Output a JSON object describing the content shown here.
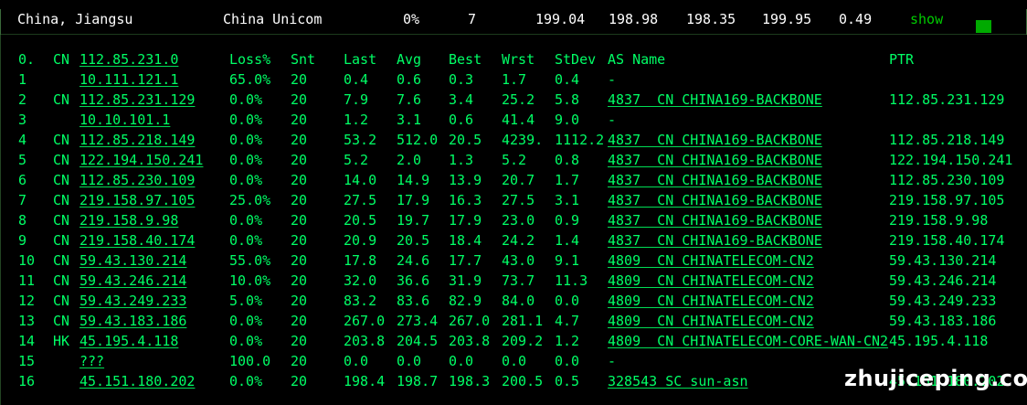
{
  "summary": {
    "location": "China, Jiangsu",
    "isp": "China Unicom",
    "loss": "0%",
    "sent": "7",
    "last": "199.04",
    "avg": "198.98",
    "best": "198.35",
    "worst": "199.95",
    "stdev": "0.49",
    "show_label": "show"
  },
  "table": {
    "headers": {
      "hop": "0.",
      "cc": "CN",
      "host": "112.85.231.0",
      "loss": "Loss%",
      "snt": "Snt",
      "last": "Last",
      "avg": "Avg",
      "best": "Best",
      "wrst": "Wrst",
      "stdev": "StDev",
      "as": "AS Name",
      "ptr": "PTR"
    },
    "rows": [
      {
        "hop": "1",
        "cc": "",
        "host": "10.111.121.1",
        "loss": "65.0%",
        "snt": "20",
        "last": "0.4",
        "avg": "0.6",
        "best": "0.3",
        "wrst": "1.7",
        "stdev": "0.4",
        "as": "-",
        "ptr": ""
      },
      {
        "hop": "2",
        "cc": "CN",
        "host": "112.85.231.129",
        "loss": "0.0%",
        "snt": "20",
        "last": "7.9",
        "avg": "7.6",
        "best": "3.4",
        "wrst": "25.2",
        "stdev": "5.8",
        "as": "4837  CN CHINA169-BACKBONE",
        "ptr": "112.85.231.129"
      },
      {
        "hop": "3",
        "cc": "",
        "host": "10.10.101.1",
        "loss": "0.0%",
        "snt": "20",
        "last": "1.2",
        "avg": "3.1",
        "best": "0.6",
        "wrst": "41.4",
        "stdev": "9.0",
        "as": "-",
        "ptr": ""
      },
      {
        "hop": "4",
        "cc": "CN",
        "host": "112.85.218.149",
        "loss": "0.0%",
        "snt": "20",
        "last": "53.2",
        "avg": "512.0",
        "best": "20.5",
        "wrst": "4239.",
        "stdev": "1112.2",
        "as": "4837  CN CHINA169-BACKBONE",
        "ptr": "112.85.218.149"
      },
      {
        "hop": "5",
        "cc": "CN",
        "host": "122.194.150.241",
        "loss": "0.0%",
        "snt": "20",
        "last": "5.2",
        "avg": "2.0",
        "best": "1.3",
        "wrst": "5.2",
        "stdev": "0.8",
        "as": "4837  CN CHINA169-BACKBONE",
        "ptr": "122.194.150.241"
      },
      {
        "hop": "6",
        "cc": "CN",
        "host": "112.85.230.109",
        "loss": "0.0%",
        "snt": "20",
        "last": "14.0",
        "avg": "14.9",
        "best": "13.9",
        "wrst": "20.7",
        "stdev": "1.7",
        "as": "4837  CN CHINA169-BACKBONE",
        "ptr": "112.85.230.109"
      },
      {
        "hop": "7",
        "cc": "CN",
        "host": "219.158.97.105",
        "loss": "25.0%",
        "snt": "20",
        "last": "27.5",
        "avg": "17.9",
        "best": "16.3",
        "wrst": "27.5",
        "stdev": "3.1",
        "as": "4837  CN CHINA169-BACKBONE",
        "ptr": "219.158.97.105"
      },
      {
        "hop": "8",
        "cc": "CN",
        "host": "219.158.9.98",
        "loss": "0.0%",
        "snt": "20",
        "last": "20.5",
        "avg": "19.7",
        "best": "17.9",
        "wrst": "23.0",
        "stdev": "0.9",
        "as": "4837  CN CHINA169-BACKBONE",
        "ptr": "219.158.9.98"
      },
      {
        "hop": "9",
        "cc": "CN",
        "host": "219.158.40.174",
        "loss": "0.0%",
        "snt": "20",
        "last": "20.9",
        "avg": "20.5",
        "best": "18.4",
        "wrst": "24.2",
        "stdev": "1.4",
        "as": "4837  CN CHINA169-BACKBONE",
        "ptr": "219.158.40.174"
      },
      {
        "hop": "10",
        "cc": "CN",
        "host": "59.43.130.214",
        "loss": "55.0%",
        "snt": "20",
        "last": "17.8",
        "avg": "24.6",
        "best": "17.7",
        "wrst": "43.0",
        "stdev": "9.1",
        "as": "4809  CN CHINATELECOM-CN2",
        "ptr": "59.43.130.214"
      },
      {
        "hop": "11",
        "cc": "CN",
        "host": "59.43.246.214",
        "loss": "10.0%",
        "snt": "20",
        "last": "32.0",
        "avg": "36.6",
        "best": "31.9",
        "wrst": "73.7",
        "stdev": "11.3",
        "as": "4809  CN CHINATELECOM-CN2",
        "ptr": "59.43.246.214"
      },
      {
        "hop": "12",
        "cc": "CN",
        "host": "59.43.249.233",
        "loss": "5.0%",
        "snt": "20",
        "last": "83.2",
        "avg": "83.6",
        "best": "82.9",
        "wrst": "84.0",
        "stdev": "0.0",
        "as": "4809  CN CHINATELECOM-CN2",
        "ptr": "59.43.249.233"
      },
      {
        "hop": "13",
        "cc": "CN",
        "host": "59.43.183.186",
        "loss": "0.0%",
        "snt": "20",
        "last": "267.0",
        "avg": "273.4",
        "best": "267.0",
        "wrst": "281.1",
        "stdev": "4.7",
        "as": "4809  CN CHINATELECOM-CN2",
        "ptr": "59.43.183.186"
      },
      {
        "hop": "14",
        "cc": "HK",
        "host": "45.195.4.118",
        "loss": "0.0%",
        "snt": "20",
        "last": "203.8",
        "avg": "204.5",
        "best": "203.8",
        "wrst": "209.2",
        "stdev": "1.2",
        "as": "4809  CN CHINATELECOM-CORE-WAN-CN2",
        "ptr": "45.195.4.118"
      },
      {
        "hop": "15",
        "cc": "",
        "host": "???",
        "loss": "100.0",
        "snt": "20",
        "last": "0.0",
        "avg": "0.0",
        "best": "0.0",
        "wrst": "0.0",
        "stdev": "0.0",
        "as": "-",
        "ptr": ""
      },
      {
        "hop": "16",
        "cc": "",
        "host": "45.151.180.202",
        "loss": "0.0%",
        "snt": "20",
        "last": "198.4",
        "avg": "198.7",
        "best": "198.3",
        "wrst": "200.5",
        "stdev": "0.5",
        "as": "328543 SC sun-asn",
        "ptr": "45.151.180.202"
      }
    ]
  },
  "watermark": "zhujiceping.com",
  "colors": {
    "background": "#000000",
    "terminal_green": "#00ff66",
    "indicator_green": "#00aa00"
  }
}
